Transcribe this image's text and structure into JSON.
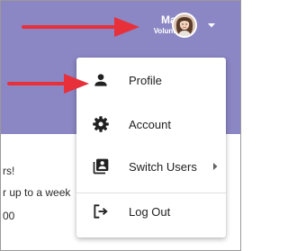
{
  "header": {
    "user_name": "Mary",
    "user_role": "Volunteer",
    "background_color": "#8b86c4"
  },
  "menu": {
    "items": [
      {
        "label": "Profile",
        "icon": "person-icon"
      },
      {
        "label": "Account",
        "icon": "gear-icon"
      },
      {
        "label": "Switch Users",
        "icon": "switch-users-icon",
        "has_submenu": true
      },
      {
        "label": "Log Out",
        "icon": "logout-icon"
      }
    ]
  },
  "content": {
    "lines": [
      "rs!",
      "r up to a week",
      "00"
    ]
  },
  "annotations": {
    "arrow_color": "#e8303a"
  }
}
